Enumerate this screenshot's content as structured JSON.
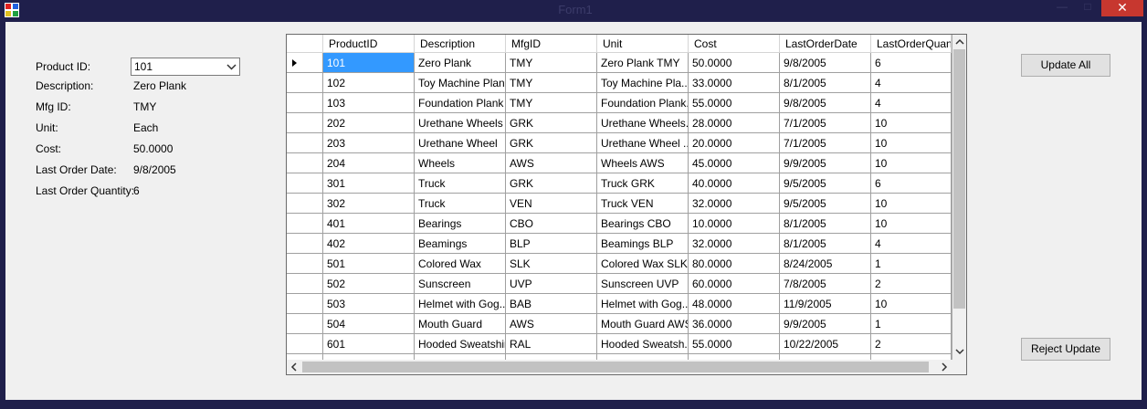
{
  "window": {
    "title": "Form1",
    "minimize": "—",
    "maximize": "□",
    "close": "✕",
    "icon": "app-icon"
  },
  "details": {
    "product_id_label": "Product ID:",
    "product_id_value": "101",
    "description_label": "Description:",
    "description_value": "Zero Plank",
    "mfg_id_label": "Mfg ID:",
    "mfg_id_value": "TMY",
    "unit_label": "Unit:",
    "unit_value": "Each",
    "cost_label": "Cost:",
    "cost_value": "50.0000",
    "last_order_date_label": "Last Order Date:",
    "last_order_date_value": "9/8/2005",
    "last_order_qty_label": "Last Order Quantity:",
    "last_order_qty_value": "6"
  },
  "grid": {
    "columns": [
      "ProductID",
      "Description",
      "MfgID",
      "Unit",
      "Cost",
      "LastOrderDate",
      "LastOrderQuantit"
    ],
    "rows": [
      [
        "101",
        "Zero Plank",
        "TMY",
        "Zero Plank TMY",
        "50.0000",
        "9/8/2005",
        "6"
      ],
      [
        "102",
        "Toy Machine Plank",
        "TMY",
        "Toy Machine Pla...",
        "33.0000",
        "8/1/2005",
        "4"
      ],
      [
        "103",
        "Foundation Plank",
        "TMY",
        "Foundation Plank...",
        "55.0000",
        "9/8/2005",
        "4"
      ],
      [
        "202",
        "Urethane Wheels",
        "GRK",
        "Urethane Wheels...",
        "28.0000",
        "7/1/2005",
        "10"
      ],
      [
        "203",
        "Urethane Wheel",
        "GRK",
        "Urethane Wheel ...",
        "20.0000",
        "7/1/2005",
        "10"
      ],
      [
        "204",
        "Wheels",
        "AWS",
        "Wheels AWS",
        "45.0000",
        "9/9/2005",
        "10"
      ],
      [
        "301",
        "Truck",
        "GRK",
        "Truck GRK",
        "40.0000",
        "9/5/2005",
        "6"
      ],
      [
        "302",
        "Truck",
        "VEN",
        "Truck VEN",
        "32.0000",
        "9/5/2005",
        "10"
      ],
      [
        "401",
        "Bearings",
        "CBO",
        "Bearings CBO",
        "10.0000",
        "8/1/2005",
        "10"
      ],
      [
        "402",
        "Beamings",
        "BLP",
        "Beamings BLP",
        "32.0000",
        "8/1/2005",
        "4"
      ],
      [
        "501",
        "Colored Wax",
        "SLK",
        "Colored Wax SLK",
        "80.0000",
        "8/24/2005",
        "1"
      ],
      [
        "502",
        "Sunscreen",
        "UVP",
        "Sunscreen UVP",
        "60.0000",
        "7/8/2005",
        "2"
      ],
      [
        "503",
        "Helmet with Gog...",
        "BAB",
        "Helmet with Gog...",
        "48.0000",
        "11/9/2005",
        "10"
      ],
      [
        "504",
        "Mouth Guard",
        "AWS",
        "Mouth Guard AWS",
        "36.0000",
        "9/9/2005",
        "1"
      ],
      [
        "601",
        "Hooded Sweatshirt",
        "RAL",
        "Hooded Sweatsh...",
        "55.0000",
        "10/22/2005",
        "2"
      ],
      [
        "",
        "",
        "",
        "",
        "",
        "",
        ""
      ]
    ],
    "selected_row": 0,
    "selected_col": 0
  },
  "buttons": {
    "update_all": "Update All",
    "reject_update": "Reject Update"
  },
  "colors": {
    "selection": "#3399ff",
    "titlebar": "#1f1f4b",
    "close": "#c7372f"
  }
}
